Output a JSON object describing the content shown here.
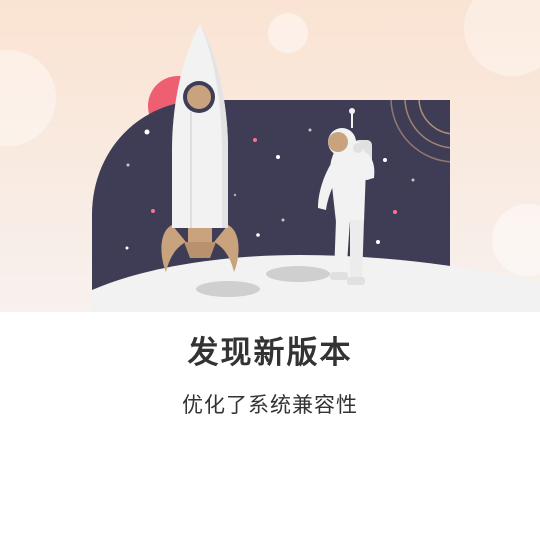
{
  "dialog": {
    "title": "发现新版本",
    "subtitle": "优化了系统兼容性"
  },
  "illustration": {
    "icons": [
      "rocket-icon",
      "astronaut-icon",
      "moon-surface",
      "planet-icon",
      "stars"
    ],
    "colors": {
      "sky_top": "#fbe7d8",
      "sky_bottom": "#f7efea",
      "space": "#3f3d56",
      "moon": "#f2f2f2",
      "crater": "#cfcfcf",
      "rocket_body": "#f2f2f2",
      "rocket_accent": "#c9a27e",
      "planet": "#ef5f72",
      "star_pink": "#ff6f91"
    }
  }
}
